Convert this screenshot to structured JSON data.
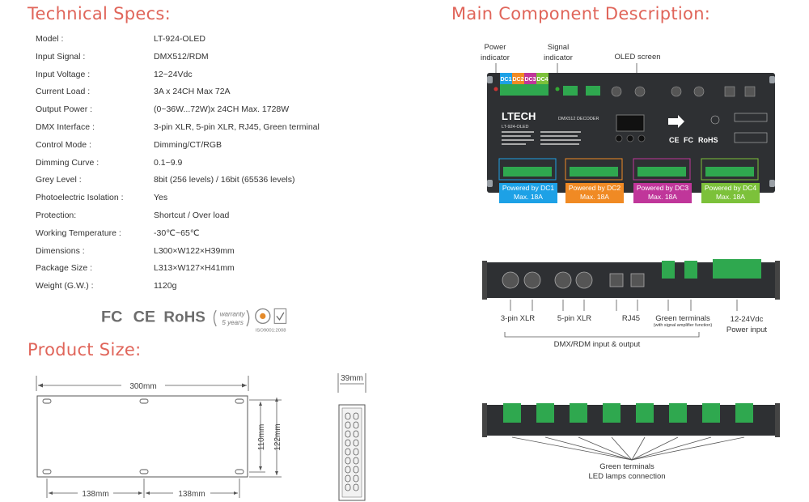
{
  "specs_title": "Technical Specs:",
  "specs": [
    {
      "label": "Model :",
      "value": "LT-924-OLED"
    },
    {
      "label": "Input Signal :",
      "value": "DMX512/RDM"
    },
    {
      "label": "Input Voltage :",
      "value": "12~24Vdc"
    },
    {
      "label": "Current Load :",
      "value": "3A x 24CH   Max 72A"
    },
    {
      "label": "Output Power :",
      "value": "(0~36W...72W)x 24CH  Max. 1728W"
    },
    {
      "label": "DMX Interface :",
      "value": "3-pin XLR, 5-pin XLR, RJ45, Green terminal"
    },
    {
      "label": "Control Mode :",
      "value": "Dimming/CT/RGB"
    },
    {
      "label": "Dimming Curve :",
      "value": "0.1~9.9"
    },
    {
      "label": "Grey Level :",
      "value": "8bit (256 levels) / 16bit (65536 levels)"
    },
    {
      "label": "Photoelectric Isolation :",
      "value": "Yes"
    },
    {
      "label": "Protection:",
      "value": "Shortcut / Over load"
    },
    {
      "label": "Working Temperature :",
      "value": "-30℃~65℃"
    },
    {
      "label": "Dimensions :",
      "value": "L300×W122×H39mm"
    },
    {
      "label": "Package Size :",
      "value": "L313×W127×H41mm"
    },
    {
      "label": "Weight (G.W.) :",
      "value": "1120g"
    }
  ],
  "certs": {
    "fc": "FC",
    "ce": "CE",
    "rohs": "RoHS",
    "warranty_1": "warranty",
    "warranty_2": "5 years",
    "iso": "ISO9001:2008"
  },
  "size_title": "Product Size:",
  "dims": {
    "length": "300mm",
    "half_left": "138mm",
    "half_right": "138mm",
    "inner_h": "110mm",
    "outer_h": "122mm",
    "depth": "39mm"
  },
  "component_title": "Main Component Description:",
  "callouts": {
    "power_1": "Power",
    "power_2": "indicator",
    "signal_1": "Signal",
    "signal_2": "indicator",
    "oled": "OLED screen"
  },
  "device": {
    "brand": "LTECH",
    "model": "LT-924-OLED",
    "name": "DMX512 DECODER",
    "ce": "CE",
    "fc": "FC",
    "rohs": "RoHS",
    "dc_tabs": [
      "DC1",
      "DC2",
      "DC3",
      "DC4"
    ]
  },
  "powered": [
    {
      "line1": "Powered by DC1",
      "line2": "Max. 18A",
      "color": "#1da1e6"
    },
    {
      "line1": "Powered by DC2",
      "line2": "Max. 18A",
      "color": "#f08a24"
    },
    {
      "line1": "Powered by DC3",
      "line2": "Max. 18A",
      "color": "#c0369a"
    },
    {
      "line1": "Powered by DC4",
      "line2": "Max. 18A",
      "color": "#7cc13a"
    }
  ],
  "side_labels": {
    "xlr3": "3-pin XLR",
    "xlr5": "5-pin XLR",
    "rj45": "RJ45",
    "green": "Green terminals",
    "green_sub": "(with signal amplifier function)",
    "power_1": "12-24Vdc",
    "power_2": "Power input",
    "dmx": "DMX/RDM input & output"
  },
  "bottom_labels": {
    "line1": "Green terminals",
    "line2": "LED lamps connection"
  }
}
